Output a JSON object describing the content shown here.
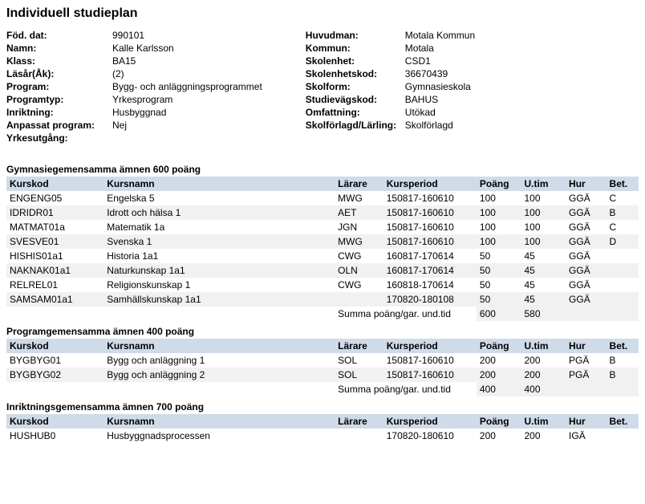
{
  "title": "Individuell studieplan",
  "info_left": [
    {
      "label": "Föd. dat:",
      "value": "990101"
    },
    {
      "label": "Namn:",
      "value": "Kalle Karlsson"
    },
    {
      "label": "Klass:",
      "value": "BA15"
    },
    {
      "label": "Läsår(Åk):",
      "value": "(2)"
    },
    {
      "label": "Program:",
      "value": "Bygg- och anläggningsprogrammet"
    },
    {
      "label": "Programtyp:",
      "value": "Yrkesprogram"
    },
    {
      "label": "Inriktning:",
      "value": "Husbyggnad"
    },
    {
      "label": "Anpassat program:",
      "value": "Nej"
    },
    {
      "label": "Yrkesutgång:",
      "value": ""
    }
  ],
  "info_right": [
    {
      "label": "Huvudman:",
      "value": "Motala Kommun"
    },
    {
      "label": "Kommun:",
      "value": "Motala"
    },
    {
      "label": "Skolenhet:",
      "value": "CSD1"
    },
    {
      "label": "Skolenhetskod:",
      "value": "36670439"
    },
    {
      "label": "Skolform:",
      "value": "Gymnasieskola"
    },
    {
      "label": "Studievägskod:",
      "value": "BAHUS"
    },
    {
      "label": "Omfattning:",
      "value": "Utökad"
    },
    {
      "label": "Skolförlagd/Lärling:",
      "value": "Skolförlagd"
    }
  ],
  "columns": {
    "kurskod": "Kurskod",
    "kursnamn": "Kursnamn",
    "larare": "Lärare",
    "kursperiod": "Kursperiod",
    "poang": "Poäng",
    "utim": "U.tim",
    "hur": "Hur",
    "bet": "Bet."
  },
  "sum_label": "Summa poäng/gar. und.tid",
  "sections": [
    {
      "title": "Gymnasiegemensamma ämnen   600 poäng",
      "rows": [
        {
          "kurskod": "ENGENG05",
          "kursnamn": "Engelska 5",
          "larare": "MWG",
          "period": "150817-160610",
          "poang": "100",
          "utim": "100",
          "hur": "GGÄ",
          "bet": "C"
        },
        {
          "kurskod": "IDRIDR01",
          "kursnamn": "Idrott och hälsa 1",
          "larare": "AET",
          "period": "150817-160610",
          "poang": "100",
          "utim": "100",
          "hur": "GGÄ",
          "bet": "B"
        },
        {
          "kurskod": "MATMAT01a",
          "kursnamn": "Matematik 1a",
          "larare": "JGN",
          "period": "150817-160610",
          "poang": "100",
          "utim": "100",
          "hur": "GGÄ",
          "bet": "C"
        },
        {
          "kurskod": "SVESVE01",
          "kursnamn": "Svenska 1",
          "larare": "MWG",
          "period": "150817-160610",
          "poang": "100",
          "utim": "100",
          "hur": "GGÄ",
          "bet": "D"
        },
        {
          "kurskod": "HISHIS01a1",
          "kursnamn": "Historia 1a1",
          "larare": "CWG",
          "period": "160817-170614",
          "poang": "50",
          "utim": "45",
          "hur": "GGÄ",
          "bet": ""
        },
        {
          "kurskod": "NAKNAK01a1",
          "kursnamn": "Naturkunskap 1a1",
          "larare": "OLN",
          "period": "160817-170614",
          "poang": "50",
          "utim": "45",
          "hur": "GGÄ",
          "bet": ""
        },
        {
          "kurskod": "RELREL01",
          "kursnamn": "Religionskunskap 1",
          "larare": "CWG",
          "period": "160818-170614",
          "poang": "50",
          "utim": "45",
          "hur": "GGÄ",
          "bet": ""
        },
        {
          "kurskod": "SAMSAM01a1",
          "kursnamn": "Samhällskunskap 1a1",
          "larare": "",
          "period": "170820-180108",
          "poang": "50",
          "utim": "45",
          "hur": "GGÄ",
          "bet": ""
        }
      ],
      "sum_poang": "600",
      "sum_utim": "580"
    },
    {
      "title": "Programgemensamma ämnen   400 poäng",
      "rows": [
        {
          "kurskod": "BYGBYG01",
          "kursnamn": "Bygg och anläggning 1",
          "larare": "SOL",
          "period": "150817-160610",
          "poang": "200",
          "utim": "200",
          "hur": "PGÄ",
          "bet": "B"
        },
        {
          "kurskod": "BYGBYG02",
          "kursnamn": "Bygg och anläggning 2",
          "larare": "SOL",
          "period": "150817-160610",
          "poang": "200",
          "utim": "200",
          "hur": "PGÄ",
          "bet": "B"
        }
      ],
      "sum_poang": "400",
      "sum_utim": "400"
    },
    {
      "title": "Inriktningsgemensamma ämnen   700 poäng",
      "rows": [
        {
          "kurskod": "HUSHUB0",
          "kursnamn": "Husbyggnadsprocessen",
          "larare": "",
          "period": "170820-180610",
          "poang": "200",
          "utim": "200",
          "hur": "IGÄ",
          "bet": ""
        }
      ],
      "sum_poang": "",
      "sum_utim": ""
    }
  ]
}
